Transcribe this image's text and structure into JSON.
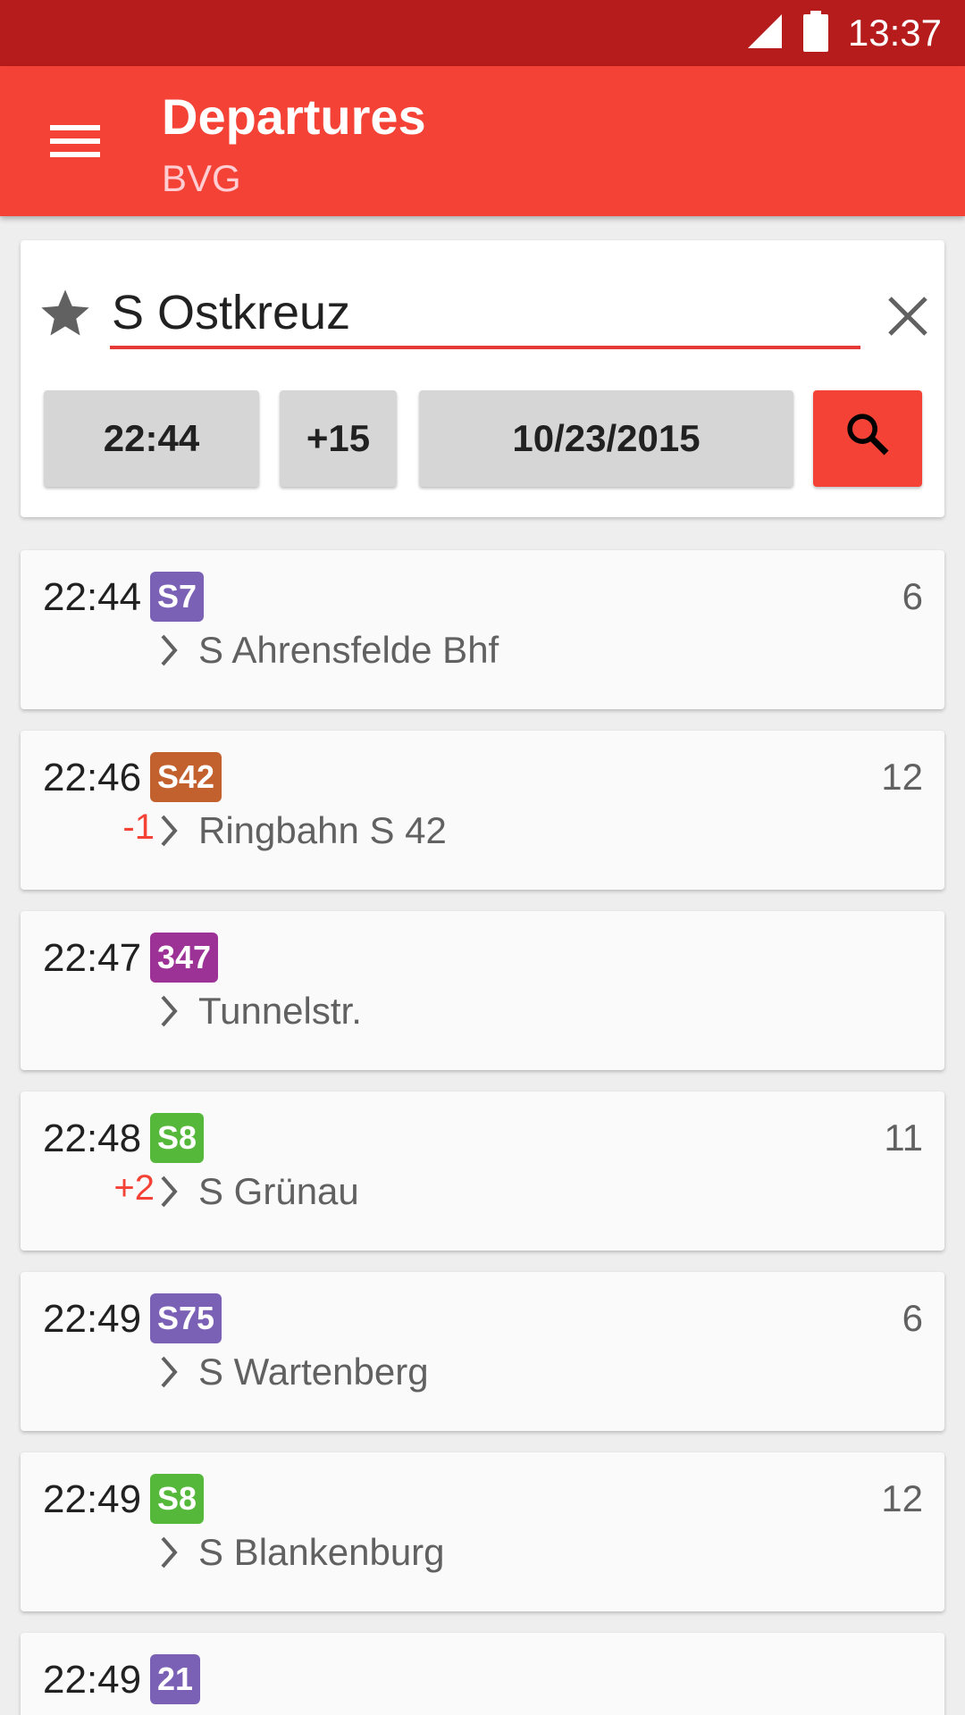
{
  "status": {
    "time": "13:37",
    "signal_icon": "signal-icon",
    "battery_icon": "battery-icon"
  },
  "toolbar": {
    "title": "Departures",
    "subtitle": "BVG",
    "menu_icon": "menu-icon",
    "color": "#f44336"
  },
  "search": {
    "station": "S Ostkreuz",
    "time": "22:44",
    "offset": "+15",
    "date": "10/23/2015",
    "favorite_icon": "star-icon",
    "clear_icon": "close-icon",
    "search_icon": "search-icon"
  },
  "departures": [
    {
      "time": "22:44",
      "delay": "",
      "line": "S7",
      "line_color": "#7b61b5",
      "platform": "6",
      "destination": "S Ahrensfelde Bhf"
    },
    {
      "time": "22:46",
      "delay": "-1",
      "line": "S42",
      "line_color": "#c2602e",
      "platform": "12",
      "destination": "Ringbahn S 42"
    },
    {
      "time": "22:47",
      "delay": "",
      "line": "347",
      "line_color": "#9c3196",
      "platform": "",
      "destination": "Tunnelstr."
    },
    {
      "time": "22:48",
      "delay": "+2",
      "line": "S8",
      "line_color": "#55b83b",
      "platform": "11",
      "destination": "S Grünau"
    },
    {
      "time": "22:49",
      "delay": "",
      "line": "S75",
      "line_color": "#7b61b5",
      "platform": "6",
      "destination": "S Wartenberg"
    },
    {
      "time": "22:49",
      "delay": "",
      "line": "S8",
      "line_color": "#55b83b",
      "platform": "12",
      "destination": "S Blankenburg"
    },
    {
      "time": "22:49",
      "delay": "",
      "line": "21",
      "line_color": "#7b61b5",
      "platform": "",
      "destination": ""
    }
  ]
}
